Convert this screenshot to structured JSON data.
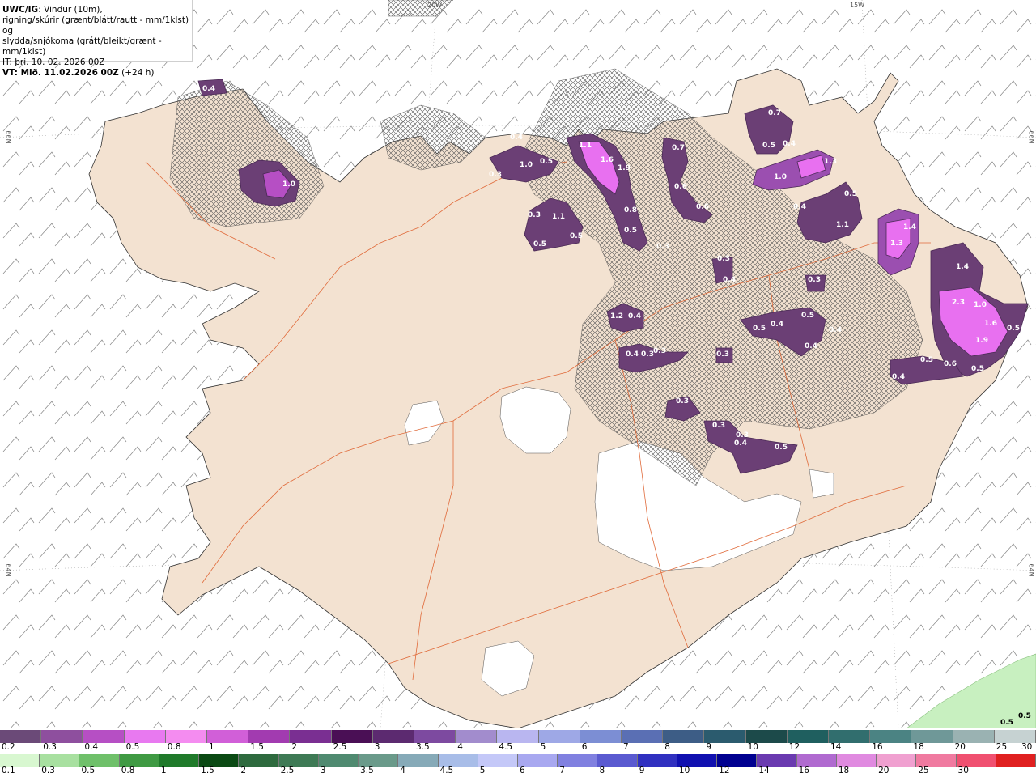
{
  "header": {
    "model": "UWC/IG",
    "title_rest": ": Vindur (10m),",
    "line2": "rigning/skúrir (grænt/blátt/rautt - mm/1klst) og",
    "line3": "slydda/snjókoma (grátt/bleikt/grænt - mm/1klst)",
    "it_line": "IT: þri. 10. 02. 2026 00Z",
    "vt_line": "VT: Mið. 11.02.2026 00Z",
    "vt_lead": " (+24 h)"
  },
  "grid_labels": {
    "lon20": "20W",
    "lon15": "15W",
    "lat66_left": "66N",
    "lat66_right": "66N",
    "lat64_left": "64N",
    "lat64_right": "64N"
  },
  "map": {
    "colors": {
      "sea": "#ffffff",
      "land": "#f3e2d1",
      "roads": "#e06a3a",
      "snow_dark": "#6b3f75",
      "snow_mid": "#9b4fb0",
      "snow_light": "#e870f0",
      "rain_light": "#c8f0c0"
    },
    "precip_labels": [
      "0.4",
      "1.0",
      "0.4",
      "1.0",
      "0.5",
      "0.3",
      "1.1",
      "1.6",
      "1.9",
      "0.3",
      "1.1",
      "0.5",
      "0.5",
      "0.8",
      "0.5",
      "0.3",
      "0.7",
      "0.6",
      "0.6",
      "0.7",
      "0.5",
      "0.4",
      "1.3",
      "1.0",
      "0.4",
      "0.5",
      "1.1",
      "1.4",
      "1.3",
      "1.4",
      "2.3",
      "1.0",
      "1.6",
      "1.9",
      "0.3",
      "0.4",
      "0.3",
      "0.5",
      "0.4",
      "0.5",
      "0.4",
      "0.4",
      "0.4",
      "0.3",
      "0.3",
      "0.4",
      "0.6",
      "0.5",
      "0.4",
      "0.3",
      "0.3",
      "0.5",
      "0.3",
      "1.2",
      "0.4",
      "0.3",
      "0.5",
      "0.5"
    ]
  },
  "legend": {
    "snow": {
      "colors": [
        "#6b4a78",
        "#8e4f9e",
        "#b64fc4",
        "#e879f0",
        "#f48cf0",
        "#d15fd8",
        "#a23bb0",
        "#7a2f92",
        "#4a0f55",
        "#5c2a70",
        "#7d4aa0",
        "#a28ccd",
        "#b9b6f0",
        "#9ea8e6",
        "#7c8ed4",
        "#5a6fb4",
        "#3d5d86",
        "#2b5b6e",
        "#1c4a4a",
        "#1f5f5f",
        "#316e6e",
        "#4b8383",
        "#6f9898",
        "#9ab2b2",
        "#c6d2d2"
      ],
      "labels": [
        "0.2",
        "0.3",
        "0.4",
        "0.5",
        "0.8",
        "1",
        "1.5",
        "2",
        "2.5",
        "3",
        "3.5",
        "4",
        "4.5",
        "5",
        "6",
        "7",
        "8",
        "9",
        "10",
        "12",
        "14",
        "16",
        "18",
        "20",
        "25",
        "30"
      ]
    },
    "rain": {
      "colors": [
        "#d8f7d0",
        "#a8e0a0",
        "#6fc06a",
        "#3f9a43",
        "#1f7a2a",
        "#0b4a14",
        "#2e6a3e",
        "#3e7a55",
        "#4f8a70",
        "#6a9a8a",
        "#86aab8",
        "#a8bde8",
        "#c4c8f8",
        "#a8a8f0",
        "#8080e0",
        "#5a5ad0",
        "#3030c0",
        "#1010b0",
        "#000090",
        "#6a3ab0",
        "#b06ad0",
        "#e08ae0",
        "#f0a0d0",
        "#f07aa0",
        "#f05070",
        "#e02020"
      ],
      "labels": [
        "0.1",
        "0.3",
        "0.5",
        "0.8",
        "1",
        "1.5",
        "2",
        "2.5",
        "3",
        "3.5",
        "4",
        "4.5",
        "5",
        "6",
        "7",
        "8",
        "9",
        "10",
        "12",
        "14",
        "16",
        "18",
        "20",
        "25",
        "30"
      ]
    }
  },
  "corner_labels": [
    "0.5",
    "0.5"
  ]
}
